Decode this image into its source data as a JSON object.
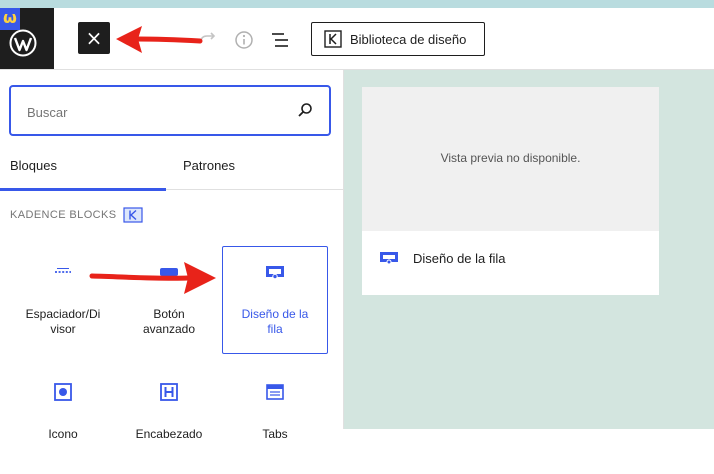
{
  "toolbar": {
    "brand_badge": "ω",
    "close_label": "×",
    "icons": [
      "wordpress-icon",
      "close-icon",
      "redo-icon",
      "info-icon",
      "outline-icon",
      "kadence-icon"
    ],
    "library_label": "Biblioteca de diseño"
  },
  "inserter": {
    "search": {
      "placeholder": "Buscar",
      "value": ""
    },
    "tabs": [
      {
        "label": "Bloques",
        "active": true
      },
      {
        "label": "Patrones",
        "active": false
      }
    ],
    "category": "KADENCE BLOCKS",
    "blocks": [
      {
        "label": "Espaciador/Divisor",
        "line1": "Espaciador/Di",
        "line2": "visor",
        "icon": "spacer-icon"
      },
      {
        "label": "Botón avanzado",
        "line1": "Botón",
        "line2": "avanzado",
        "icon": "button-icon"
      },
      {
        "label": "Diseño de la fila",
        "line1": "Diseño de la",
        "line2": "fila",
        "icon": "row-layout-icon",
        "selected": true
      },
      {
        "label": "Icono",
        "line1": "Icono",
        "line2": "",
        "icon": "icon-block-icon"
      },
      {
        "label": "Encabezado",
        "line1": "Encabezado",
        "line2": "",
        "icon": "heading-icon"
      },
      {
        "label": "Tabs",
        "line1": "Tabs",
        "line2": "",
        "icon": "tabs-icon"
      }
    ]
  },
  "preview": {
    "message": "Vista previa no disponible.",
    "title": "Diseño de la fila"
  },
  "colors": {
    "accent": "#3858e9",
    "editor_bg": "#d3e5df",
    "annotation_arrow": "#e8231a"
  }
}
